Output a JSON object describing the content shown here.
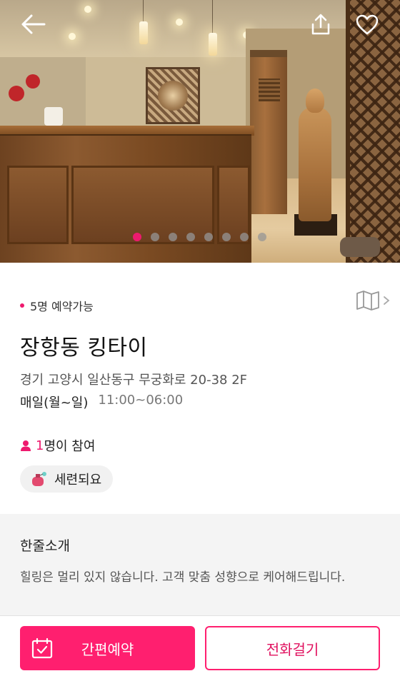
{
  "gallery": {
    "dot_count": 8,
    "active_index": 0,
    "icons": {
      "back": "back-arrow-icon",
      "share": "share-icon",
      "favorite": "heart-icon"
    }
  },
  "info": {
    "availability": "5명 예약가능",
    "title": "장항동 킹타이",
    "address": "경기 고양시 일산동구 무궁화로 20-38 2F",
    "hours_days": "매일(월~일)",
    "hours_time": "11:00~06:00",
    "participants_count": "1",
    "participants_label": "명이 참여",
    "tag_label": "세련되요",
    "map_icon": "map-icon"
  },
  "intro": {
    "title": "한줄소개",
    "text": "힐링은 멀리 있지 않습니다. 고객 맞춤 성향으로 케어해드립니다."
  },
  "actions": {
    "reserve_label": "간편예약",
    "call_label": "전화걸기"
  },
  "colors": {
    "accent": "#ff1f6f",
    "text": "#222222"
  }
}
